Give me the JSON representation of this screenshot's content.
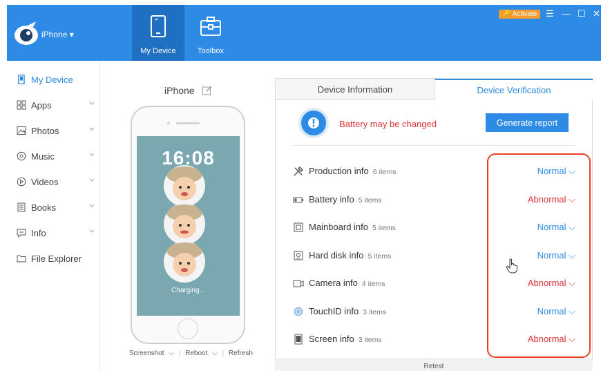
{
  "header": {
    "device_selector": "iPhone ▾",
    "nav": [
      {
        "label": "My Device"
      },
      {
        "label": "Toolbox"
      }
    ],
    "activate_label": "🔑 Activate"
  },
  "sidebar": {
    "items": [
      {
        "label": "My Device",
        "icon": "phone-icon"
      },
      {
        "label": "Apps",
        "icon": "apps-grid-icon"
      },
      {
        "label": "Photos",
        "icon": "photo-icon"
      },
      {
        "label": "Music",
        "icon": "music-icon"
      },
      {
        "label": "Videos",
        "icon": "video-play-icon"
      },
      {
        "label": "Books",
        "icon": "book-icon"
      },
      {
        "label": "Info",
        "icon": "chat-info-icon"
      },
      {
        "label": "File Explorer",
        "icon": "folder-icon"
      }
    ]
  },
  "phone": {
    "title": "iPhone",
    "time": "16:08",
    "charging": "Charging...",
    "actions": {
      "screenshot": "Screenshot",
      "reboot": "Reboot",
      "refresh": "Refresh"
    }
  },
  "panel": {
    "tabs": [
      {
        "label": "Device Information"
      },
      {
        "label": "Device Verification"
      }
    ],
    "warning": "Battery may be changed",
    "generate_button": "Generate report",
    "rows": [
      {
        "name": "Production info",
        "count": "6 items",
        "status": "Normal"
      },
      {
        "name": "Battery info",
        "count": "5 items",
        "status": "Abnormal"
      },
      {
        "name": "Mainboard info",
        "count": "5 items",
        "status": "Normal"
      },
      {
        "name": "Hard disk info",
        "count": "5 items",
        "status": "Normal"
      },
      {
        "name": "Camera info",
        "count": "4 items",
        "status": "Abnormal"
      },
      {
        "name": "TouchID info",
        "count": "3 items",
        "status": "Normal"
      },
      {
        "name": "Screen info",
        "count": "3 items",
        "status": "Abnormal"
      }
    ],
    "retest": "Retest"
  },
  "colors": {
    "accent": "#2e8be5",
    "abnormal": "#e0353b",
    "highlight": "#ec3d22",
    "activate": "#f39b2c"
  }
}
